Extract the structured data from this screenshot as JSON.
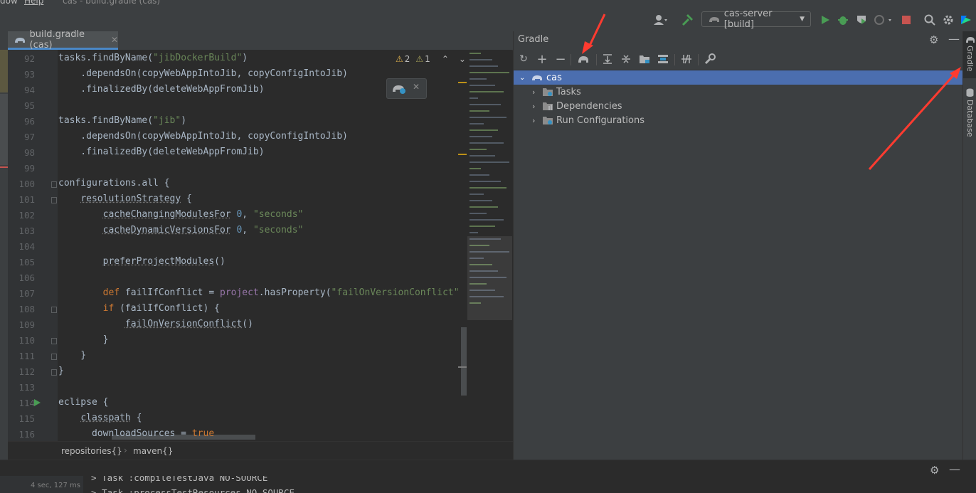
{
  "menu": {
    "window_label": "dow",
    "help_label": "Help",
    "title": "cas - build.gradle (cas)"
  },
  "toolbar": {
    "run_config": "cas-server [build]"
  },
  "editor": {
    "tab_label": "build.gradle (cas)",
    "inspections": {
      "warnings": "2",
      "weak_warnings": "1"
    },
    "lines": [
      {
        "n": "92",
        "t": "tasks.findByName(\"jibDockerBuild\")"
      },
      {
        "n": "93",
        "t": "    .dependsOn(copyWebAppIntoJib, copyConfigIntoJib)"
      },
      {
        "n": "94",
        "t": "    .finalizedBy(deleteWebAppFromJib)"
      },
      {
        "n": "95",
        "t": ""
      },
      {
        "n": "96",
        "t": "tasks.findByName(\"jib\")"
      },
      {
        "n": "97",
        "t": "    .dependsOn(copyWebAppIntoJib, copyConfigIntoJib)"
      },
      {
        "n": "98",
        "t": "    .finalizedBy(deleteWebAppFromJib)"
      },
      {
        "n": "99",
        "t": ""
      },
      {
        "n": "100",
        "t": "configurations.all {"
      },
      {
        "n": "101",
        "t": "    resolutionStrategy {"
      },
      {
        "n": "102",
        "t": "        cacheChangingModulesFor 0, \"seconds\""
      },
      {
        "n": "103",
        "t": "        cacheDynamicVersionsFor 0, \"seconds\""
      },
      {
        "n": "104",
        "t": ""
      },
      {
        "n": "105",
        "t": "        preferProjectModules()"
      },
      {
        "n": "106",
        "t": ""
      },
      {
        "n": "107",
        "t": "        def failIfConflict = project.hasProperty(\"failOnVersionConflict\""
      },
      {
        "n": "108",
        "t": "        if (failIfConflict) {"
      },
      {
        "n": "109",
        "t": "            failOnVersionConflict()"
      },
      {
        "n": "110",
        "t": "        }"
      },
      {
        "n": "111",
        "t": "    }"
      },
      {
        "n": "112",
        "t": "}"
      },
      {
        "n": "113",
        "t": ""
      },
      {
        "n": "114",
        "t": "eclipse {"
      },
      {
        "n": "115",
        "t": "    classpath {"
      },
      {
        "n": "116",
        "t": "      downloadSources = true"
      }
    ],
    "breadcrumb": [
      "repositories{}",
      "maven{}"
    ]
  },
  "gradle": {
    "title": "Gradle",
    "tree": {
      "root": "cas",
      "children": [
        "Tasks",
        "Dependencies",
        "Run Configurations"
      ]
    }
  },
  "right_strip": {
    "gradle_tab": "Gradle",
    "database_tab": "Database"
  },
  "bottom": {
    "timing": "4 sec, 127 ms",
    "output_line_1": "> Task :compileTestJava NO-SOURCE",
    "output_line_2": "> Task :processTestResources NO-SOURCE"
  },
  "colors": {
    "accent": "#4a88c7",
    "selection": "#4b6eaf",
    "annotation_arrow": "#ff3b30"
  }
}
